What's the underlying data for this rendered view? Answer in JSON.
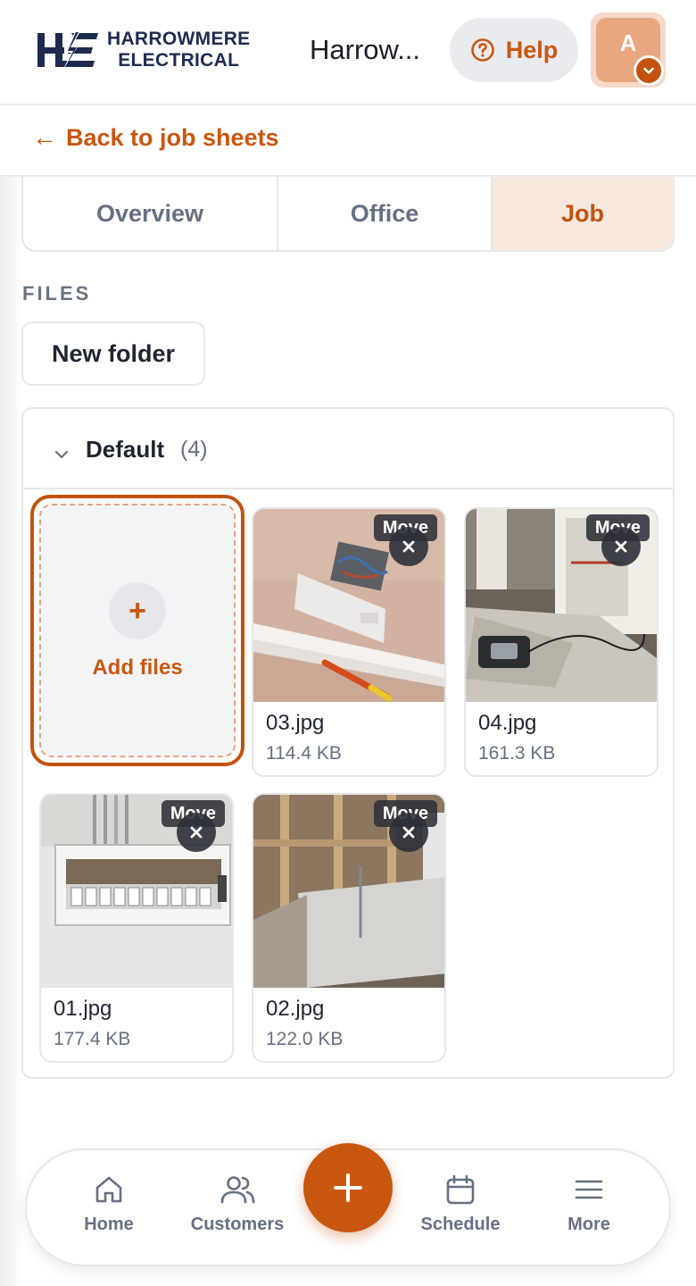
{
  "header": {
    "logo_line1": "HARROWMERE",
    "logo_line2": "ELECTRICAL",
    "app_title": "Harrow...",
    "help_label": "Help",
    "avatar_initial": "A"
  },
  "back": {
    "label": "Back to job sheets"
  },
  "tabs": [
    {
      "label": "Overview",
      "active": false
    },
    {
      "label": "Office",
      "active": false
    },
    {
      "label": "Job",
      "active": true
    }
  ],
  "files": {
    "section_label": "FILES",
    "new_folder_label": "New folder",
    "folder": {
      "name": "Default",
      "count": "(4)",
      "add_files_label": "Add files",
      "items": [
        {
          "name": "03.jpg",
          "size": "114.4 KB",
          "badge": "Move"
        },
        {
          "name": "04.jpg",
          "size": "161.3 KB",
          "badge": "Move"
        },
        {
          "name": "01.jpg",
          "size": "177.4 KB",
          "badge": "Move"
        },
        {
          "name": "02.jpg",
          "size": "122.0 KB",
          "badge": "Move"
        }
      ]
    }
  },
  "nav": {
    "home": "Home",
    "customers": "Customers",
    "schedule": "Schedule",
    "more": "More"
  },
  "colors": {
    "accent": "#c95710",
    "accent_light": "#f8e9df",
    "text_muted": "#667083"
  }
}
